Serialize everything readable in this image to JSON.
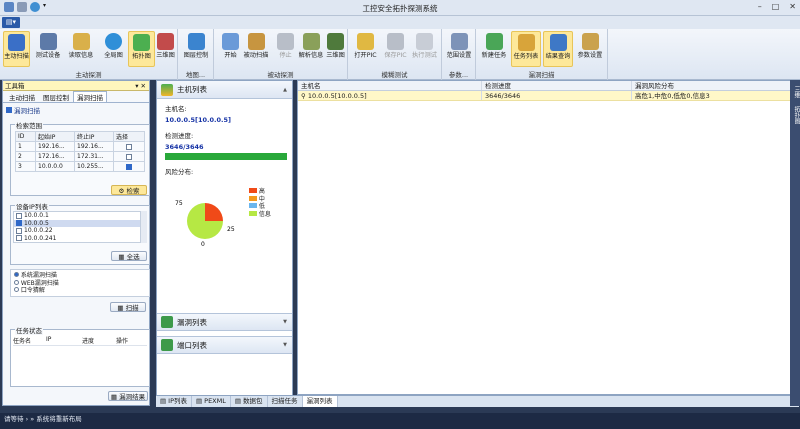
{
  "window": {
    "title": "工控安全拓扑探测系统"
  },
  "ribbon": {
    "groups": [
      {
        "label": "主动探测",
        "buttons": [
          "主动扫描",
          "测试设备",
          "读取信息",
          "全局图",
          "拓扑图",
          "三维图"
        ]
      },
      {
        "label": "地图...",
        "buttons": [
          "图层控制"
        ]
      },
      {
        "label": "被动探测",
        "buttons": [
          "开始",
          "被动扫描",
          "停止",
          "解析信息",
          "三维图"
        ]
      },
      {
        "label": "模糊测试",
        "buttons": [
          "打开PIC",
          "保存PIC",
          "执行测试"
        ]
      },
      {
        "label": "参数...",
        "buttons": [
          "范围设置"
        ]
      },
      {
        "label": "漏洞扫描",
        "buttons": [
          "新建任务",
          "任务列表",
          "结果查询",
          "参数设置"
        ]
      }
    ]
  },
  "toolbox": {
    "title": "工具箱",
    "tabs": [
      "主动扫描",
      "图层控制",
      "漏洞扫描"
    ],
    "section": "漏洞扫描",
    "range": {
      "legend": "检索范围",
      "headers": [
        "ID",
        "起始IP",
        "终止IP",
        "选择"
      ],
      "rows": [
        {
          "id": "1",
          "start": "192.16...",
          "end": "192.16...",
          "checked": false
        },
        {
          "id": "2",
          "start": "172.16...",
          "end": "172.31...",
          "checked": false
        },
        {
          "id": "3",
          "start": "10.0.0.0",
          "end": "10.255...",
          "checked": true
        }
      ],
      "search_btn": "检索"
    },
    "ip_list": {
      "legend": "设备IP列表",
      "items": [
        {
          "ip": "10.0.0.1",
          "checked": false
        },
        {
          "ip": "10.0.0.5",
          "checked": true
        },
        {
          "ip": "10.0.0.22",
          "checked": false
        },
        {
          "ip": "10.0.0.241",
          "checked": false
        }
      ],
      "select_all": "全选"
    },
    "scan_options": [
      {
        "label": "系统漏洞扫描",
        "selected": true
      },
      {
        "label": "WEB漏洞扫描",
        "selected": false
      },
      {
        "label": "口令猜解",
        "selected": false
      }
    ],
    "scan_btn": "扫描",
    "task_status": {
      "legend": "任务状态",
      "headers": [
        "任务名",
        "IP",
        "进度",
        "操作"
      ]
    },
    "result_btn": "漏洞结果"
  },
  "host_panel": {
    "title": "主机列表",
    "host_label": "主机名:",
    "host_value": "10.0.0.5[10.0.0.5]",
    "progress_label": "检测进度:",
    "progress_value": "3646/3646",
    "progress": 1.0,
    "risk_label": "风险分布:",
    "legend": [
      {
        "label": "高",
        "color": "#f04a18"
      },
      {
        "label": "中",
        "color": "#f39a1e"
      },
      {
        "label": "低",
        "color": "#6ab6ee"
      },
      {
        "label": "信息",
        "color": "#b6e844"
      }
    ],
    "vuln_title": "漏洞列表",
    "port_title": "端口列表"
  },
  "chart_data": {
    "type": "pie",
    "categories": [
      "高",
      "中",
      "低",
      "信息"
    ],
    "values": [
      1,
      0,
      0,
      3
    ],
    "labels": [
      "25",
      "0",
      "",
      "75"
    ]
  },
  "grid": {
    "headers": [
      "主机名",
      "检测进度",
      "漏洞风险分布"
    ],
    "rows": [
      {
        "host": "10.0.0.5[10.0.0.5]",
        "progress": "3646/3646",
        "risk": "高危1,中危0,低危0,信息3"
      }
    ]
  },
  "bottom_tabs": [
    "IP列表",
    "PEXML",
    "数据包",
    "扫描任务",
    "漏洞列表"
  ],
  "right_side": [
    "三维",
    "拓扑图"
  ],
  "status": {
    "text": "请等待 › » 系统将重新布局"
  }
}
